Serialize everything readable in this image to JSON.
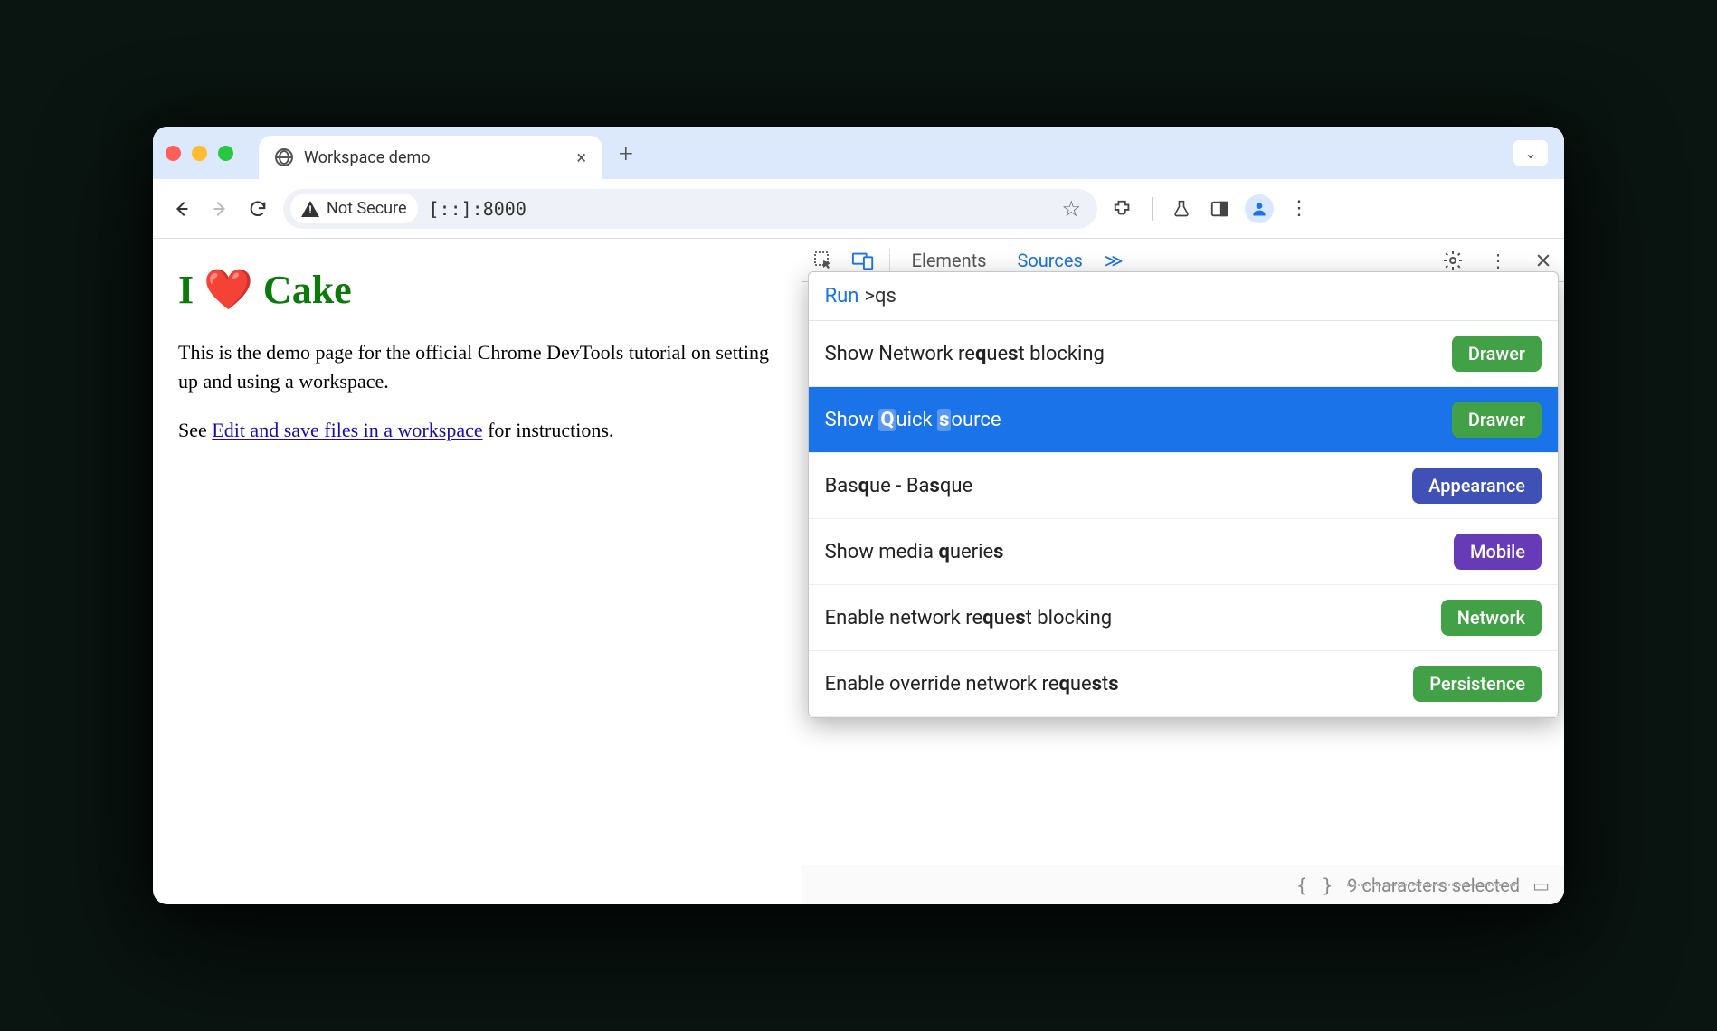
{
  "window": {
    "tab_title": "Workspace demo",
    "new_tab_glyph": "+",
    "close_glyph": "×",
    "collapse_glyph": "⌄"
  },
  "address": {
    "security_label": "Not Secure",
    "url": "[::]:8000"
  },
  "page": {
    "heading_prefix": "I ",
    "heading_heart": "❤️",
    "heading_suffix": " Cake",
    "para1": "This is the demo page for the official Chrome DevTools tutorial on setting up and using a workspace.",
    "para2_prefix": "See ",
    "para2_link": "Edit and save files in a workspace",
    "para2_suffix": " for instructions."
  },
  "devtools": {
    "tab_elements": "Elements",
    "tab_sources": "Sources",
    "more_glyph": "≫",
    "footer_text": "9 characters selected"
  },
  "command": {
    "run_label": "Run",
    "prefix": ">",
    "query": "qs",
    "items": [
      {
        "html": "Show Network re<b>q</b>ue<b>s</b>t blocking",
        "badge": "Drawer",
        "badge_cls": "green",
        "selected": false
      },
      {
        "html": "Show <span class='hl'><b>Q</b></span>uick <span class='hl'><b>s</b></span>ource",
        "badge": "Drawer",
        "badge_cls": "green",
        "selected": true
      },
      {
        "html": "Bas<b>q</b>ue - Ba<b>s</b>que",
        "badge": "Appearance",
        "badge_cls": "indigo",
        "selected": false
      },
      {
        "html": "Show media <b>q</b>uerie<b>s</b>",
        "badge": "Mobile",
        "badge_cls": "purple",
        "selected": false
      },
      {
        "html": "Enable network re<b>q</b>ue<b>s</b>t blocking",
        "badge": "Network",
        "badge_cls": "green",
        "selected": false
      },
      {
        "html": "Enable override network re<b>q</b>ue<b>s</b>t<b>s</b>",
        "badge": "Persistence",
        "badge_cls": "green",
        "selected": false
      }
    ]
  }
}
